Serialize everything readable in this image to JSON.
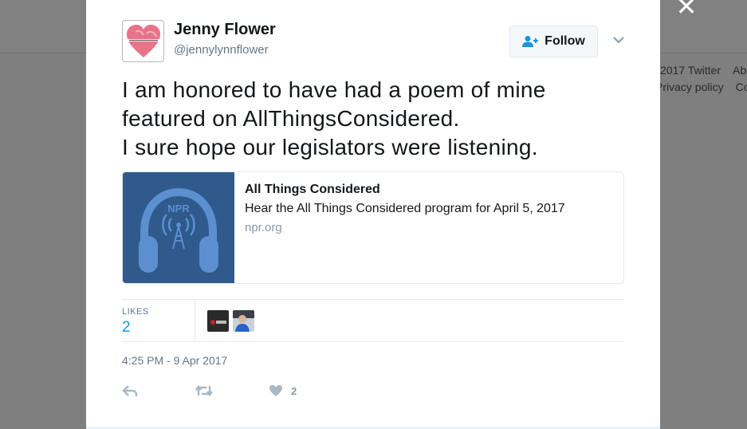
{
  "background": {
    "footer_line1": [
      "2017 Twitter",
      "About"
    ],
    "footer_line2": [
      "Privacy policy",
      "Cookies"
    ]
  },
  "close_glyph": "✕",
  "tweet": {
    "author": {
      "name": "Jenny Flower",
      "handle": "@jennylynnflower",
      "avatar_icon": "heart-icon"
    },
    "follow_label": "Follow",
    "text_lines": [
      "I am honored to have had a poem of mine",
      "featured on AllThingsConsidered.",
      "I sure hope our legislators were listening."
    ],
    "card": {
      "title": "All Things Considered",
      "description": "Hear the All Things Considered program for April 5, 2017",
      "domain": "npr.org",
      "thumb_text": "NPR",
      "thumb_color": "#2f5a8b"
    },
    "likes": {
      "label": "LIKES",
      "count": "2"
    },
    "timestamp": "4:25 PM - 9 Apr 2017",
    "actions": {
      "like_count": "2"
    }
  },
  "colors": {
    "accent": "#1b95e0",
    "muted": "#657786",
    "border": "#e1e8ed"
  }
}
